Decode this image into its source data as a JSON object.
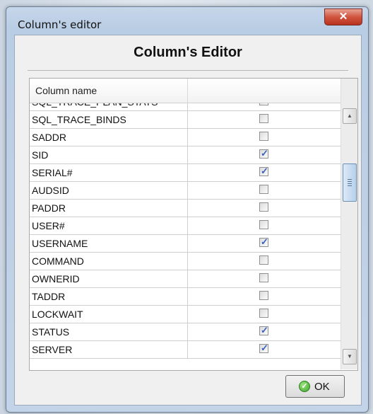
{
  "window": {
    "title": "Column's editor",
    "close_glyph": "✕"
  },
  "dialog": {
    "heading": "Column's Editor"
  },
  "grid": {
    "header": {
      "name": "Column name",
      "check": ""
    },
    "partial_top_row": {
      "name": "SQL_TRACE_PLAN_STATS",
      "checked": false
    },
    "rows": [
      {
        "name": "SQL_TRACE_BINDS",
        "checked": false
      },
      {
        "name": "SADDR",
        "checked": false
      },
      {
        "name": "SID",
        "checked": true
      },
      {
        "name": "SERIAL#",
        "checked": true
      },
      {
        "name": "AUDSID",
        "checked": false
      },
      {
        "name": "PADDR",
        "checked": false
      },
      {
        "name": "USER#",
        "checked": false
      },
      {
        "name": "USERNAME",
        "checked": true
      },
      {
        "name": "COMMAND",
        "checked": false
      },
      {
        "name": "OWNERID",
        "checked": false
      },
      {
        "name": "TADDR",
        "checked": false
      },
      {
        "name": "LOCKWAIT",
        "checked": false
      },
      {
        "name": "STATUS",
        "checked": true
      },
      {
        "name": "SERVER",
        "checked": true
      }
    ]
  },
  "icons": {
    "check": "✓",
    "scroll_up": "▲",
    "scroll_down": "▼",
    "ok": "✓"
  },
  "buttons": {
    "ok_label": "OK"
  },
  "colors": {
    "checkmark": "#3a5fbf",
    "close_button": "#c9432c",
    "ok_icon": "#3fa52a"
  }
}
